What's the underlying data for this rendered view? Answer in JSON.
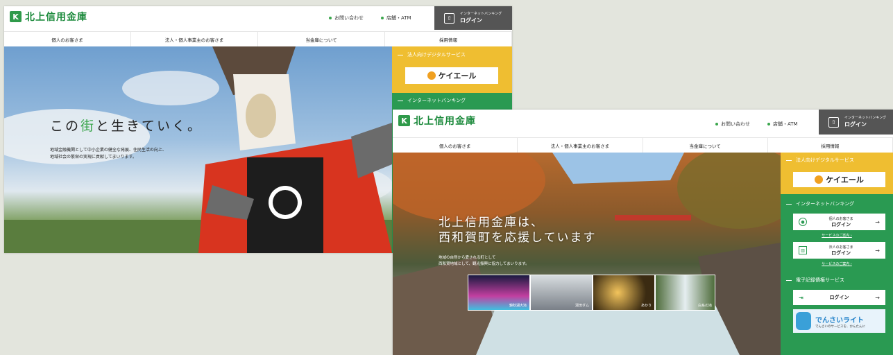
{
  "bank": {
    "name": "北上信用金庫",
    "mark": "K"
  },
  "header": {
    "contact": "お問い合わせ",
    "branch_atm": "店舗・ATM",
    "login_small": "インターネットバンキング",
    "login": "ログイン"
  },
  "nav": [
    "個人のお客さま",
    "法人・個人事業主のお客さま",
    "当金庫について",
    "採用情報"
  ],
  "screen1": {
    "catch_pre": "この",
    "catch_accent": "街",
    "catch_post": "と生きていく。",
    "desc_line1": "地域金融機関として中小企業の健全な発展、住民生活の向上、",
    "desc_line2": "地域社会の繁栄の実現に貢献してまいります。",
    "side_digital": "法人向けデジタルサービス",
    "kei_label": "ケイエール",
    "side_ib": "インターネットバンキング"
  },
  "screen2": {
    "catch_line1": "北上信用金庫は、",
    "catch_line2": "西和賀町を応援しています",
    "desc_line1": "地域の自然から愛される町として",
    "desc_line2": "西和賀地域として、観光振興に協力してまいります。",
    "thumbs": [
      "錦秋湖大滝",
      "湯田ダム",
      "あかり",
      "白糸の滝"
    ],
    "side_digital": "法人向けデジタルサービス",
    "kei_label": "ケイエール",
    "side_ib": "インターネットバンキング",
    "personal_small": "個人のお客さま",
    "personal_login": "ログイン",
    "personal_link": "サービスのご案内 ›",
    "corp_small": "法人のお客さま",
    "corp_login": "ログイン",
    "corp_link": "サービスのご案内 ›",
    "side_denshi": "電子記録債権サービス",
    "denshi_login": "ログイン",
    "densai_title": "でんさいライト",
    "densai_sub": "でんさいのサービスを、かんたんに"
  },
  "colors": {
    "brand_green": "#1c8a3c",
    "side_yellow": "#efbe31",
    "side_green": "#2a9a52",
    "header_gray": "#555555"
  }
}
